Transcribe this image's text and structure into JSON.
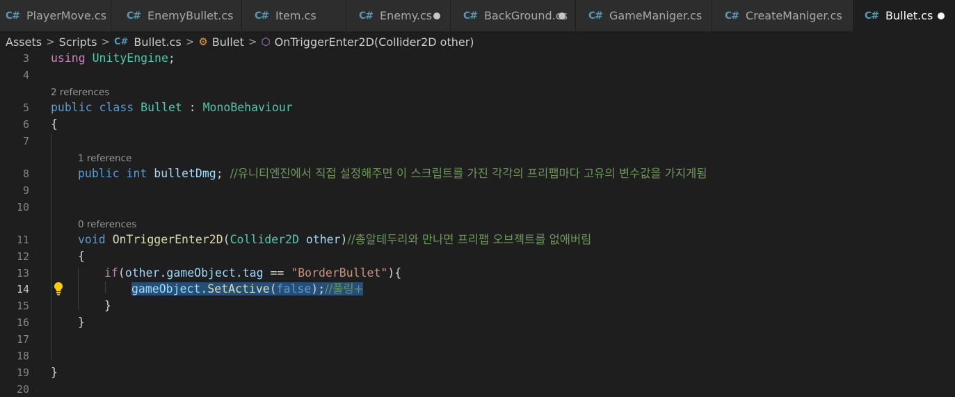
{
  "tabs": [
    {
      "label": "PlayerMove.cs",
      "modified": false,
      "active": false
    },
    {
      "label": "EnemyBullet.cs",
      "modified": false,
      "active": false
    },
    {
      "label": "Item.cs",
      "modified": false,
      "active": false
    },
    {
      "label": "Enemy.cs",
      "modified": true,
      "active": false
    },
    {
      "label": "BackGround.cs",
      "modified": true,
      "active": false
    },
    {
      "label": "GameManiger.cs",
      "modified": false,
      "active": false
    },
    {
      "label": "CreateManiger.cs",
      "modified": false,
      "active": false
    },
    {
      "label": "Bullet.cs",
      "modified": true,
      "active": true
    }
  ],
  "breadcrumb": {
    "assets": "Assets",
    "scripts": "Scripts",
    "file": "Bullet.cs",
    "class": "Bullet",
    "method": "OnTriggerEnter2D(Collider2D other)"
  },
  "colors": {
    "editor_bg": "#1e1e1e",
    "keyword": "#569cd6",
    "type": "#4ec9b0",
    "comment": "#6a9955",
    "selection": "#264f78"
  },
  "icons": {
    "tab_file": "csharp-icon",
    "class": "class-icon",
    "method": "method-cube-icon",
    "lightbulb": "lightbulb-icon"
  },
  "line_numbers": [
    "3",
    "4",
    "5",
    "6",
    "7",
    "8",
    "9",
    "10",
    "11",
    "12",
    "13",
    "14",
    "15",
    "16",
    "17",
    "18",
    "19",
    "20"
  ],
  "codelens": {
    "class_refs": "2 references",
    "field_refs": "1 reference",
    "method_refs": "0 references"
  },
  "code": {
    "l3_using": "using",
    "l3_ns": "UnityEngine",
    "l3_end": ";",
    "l5_public": "public",
    "l5_class": "class",
    "l5_name": "Bullet",
    "l5_colon": " : ",
    "l5_base": "MonoBehaviour",
    "l6": "{",
    "l8_public": "public",
    "l8_int": "int",
    "l8_var": "bulletDmg",
    "l8_semi": ";",
    "l8_comment": "//유니티엔진에서 직접 설정해주면 이 스크립트를 가진 각각의 프리팹마다 고유의 변수값을 가지게됨",
    "l11_void": "void",
    "l11_fn": "OnTriggerEnter2D",
    "l11_open": "(",
    "l11_type": "Collider2D",
    "l11_param": "other",
    "l11_close": ")",
    "l11_comment": "//총알테두리와 만나면 프리팹 오브젝트를 없애버림",
    "l12": "{",
    "l13_if": "if",
    "l13_open": "(",
    "l13_other": "other",
    "l13_dot1": ".",
    "l13_go": "gameObject",
    "l13_dot2": ".",
    "l13_tag": "tag",
    "l13_eq": " == ",
    "l13_str": "\"BorderBullet\"",
    "l13_end": "){",
    "l14_go": "gameObject",
    "l14_dot": ".",
    "l14_fn": "SetActive",
    "l14_open": "(",
    "l14_false": "false",
    "l14_close": ");",
    "l14_comment": "//풀링+",
    "l15": "}",
    "l16": "}",
    "l19": "}"
  }
}
